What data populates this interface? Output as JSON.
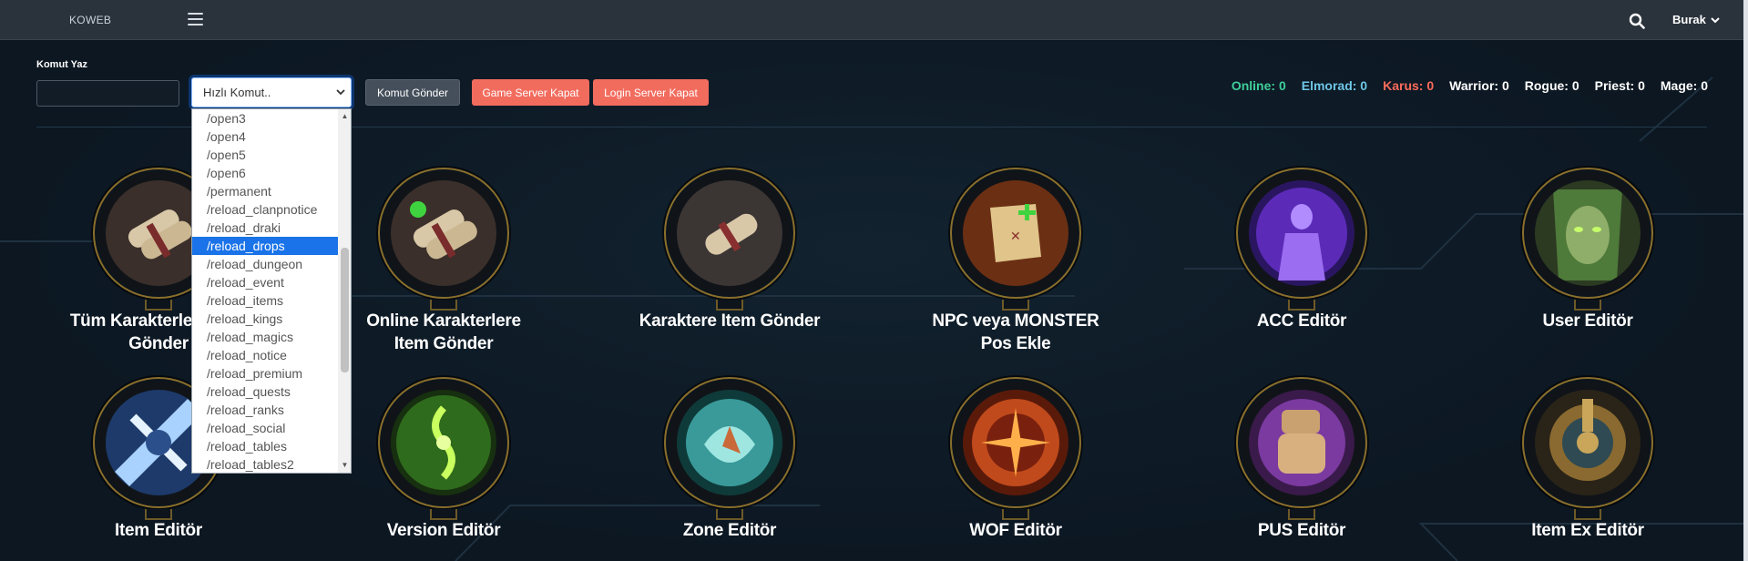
{
  "navbar": {
    "brand": "KOWEB",
    "user": "Burak"
  },
  "command": {
    "label": "Komut Yaz",
    "input_value": "",
    "select_value": "Hızlı Komut..",
    "send_label": "Komut Gönder",
    "gs_close_label": "Game Server Kapat",
    "ls_close_label": "Login Server Kapat"
  },
  "stats": {
    "online": "Online: 0",
    "elmorad": "Elmorad: 0",
    "karus": "Karus: 0",
    "warrior": "Warrior: 0",
    "rogue": "Rogue: 0",
    "priest": "Priest: 0",
    "mage": "Mage: 0"
  },
  "colors": {
    "online": "#3fcf9a",
    "elmorad": "#6ec6e6",
    "karus": "#ff6b5b",
    "danger": "#f26c5e",
    "accent": "#1a73e8"
  },
  "dropdown": {
    "items": [
      "/open3",
      "/open4",
      "/open5",
      "/open6",
      "/permanent",
      "/reload_clanpnotice",
      "/reload_draki",
      "/reload_drops",
      "/reload_dungeon",
      "/reload_event",
      "/reload_items",
      "/reload_kings",
      "/reload_magics",
      "/reload_notice",
      "/reload_premium",
      "/reload_quests",
      "/reload_ranks",
      "/reload_social",
      "/reload_tables",
      "/reload_tables2"
    ],
    "selected": "/reload_drops"
  },
  "tiles": [
    {
      "label": "Tüm Karakterlere Item Gönder",
      "icon": "scrolls-icon"
    },
    {
      "label": "Online Karakterlere Item Gönder",
      "icon": "online-scrolls-icon"
    },
    {
      "label": "Karaktere Item Gönder",
      "icon": "scroll-icon"
    },
    {
      "label": "NPC veya MONSTER Pos Ekle",
      "icon": "map-plus-icon"
    },
    {
      "label": "ACC Editör",
      "icon": "purple-figure-icon"
    },
    {
      "label": "User Editör",
      "icon": "green-face-icon"
    },
    {
      "label": "Item Editör",
      "icon": "ice-blade-icon"
    },
    {
      "label": "Version Editör",
      "icon": "green-rune-icon"
    },
    {
      "label": "Zone Editör",
      "icon": "teal-swirl-icon"
    },
    {
      "label": "WOF Editör",
      "icon": "fire-wheel-icon"
    },
    {
      "label": "PUS Editör",
      "icon": "fist-icon"
    },
    {
      "label": "Item Ex Editör",
      "icon": "gear-emblem-icon"
    }
  ]
}
